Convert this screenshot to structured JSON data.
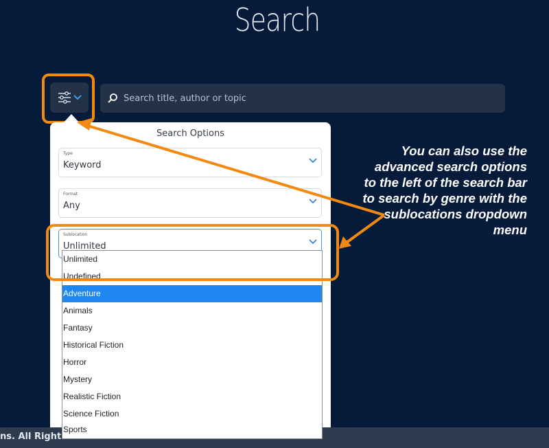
{
  "page": {
    "title": "Search"
  },
  "search": {
    "placeholder": "Search title, author or topic"
  },
  "options_panel": {
    "title": "Search Options",
    "fields": [
      {
        "label": "Type",
        "value": "Keyword"
      },
      {
        "label": "Format",
        "value": "Any"
      },
      {
        "label": "Sublocation",
        "value": "Unlimited"
      }
    ]
  },
  "dropdown": {
    "options": [
      "Unlimited",
      "Undefined",
      "Adventure",
      "Animals",
      "Fantasy",
      "Historical Fiction",
      "Horror",
      "Mystery",
      "Realistic Fiction",
      "Science Fiction",
      "Sports"
    ],
    "highlighted": "Adventure"
  },
  "callout": {
    "text": "You can also use the advanced search options to the left of the search bar to search by genre with the sublocations dropdown menu"
  },
  "footer": {
    "text": "ns. All Rights Reserved."
  },
  "colors": {
    "background": "#061a3a",
    "annotation": "#f18a12",
    "selected_option": "#1e88f0",
    "control_bg": "#243247"
  }
}
